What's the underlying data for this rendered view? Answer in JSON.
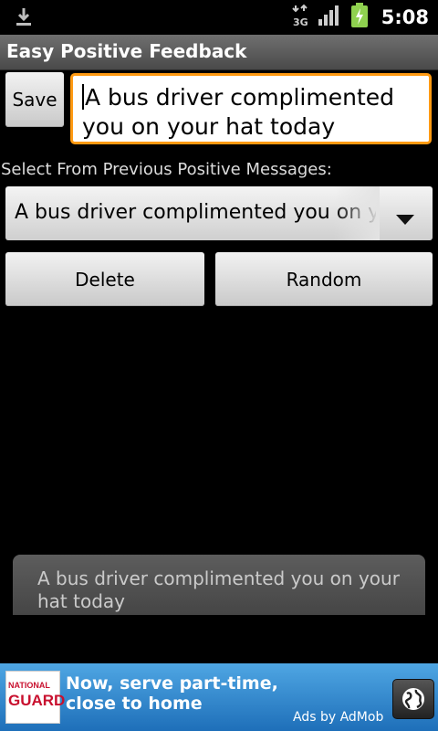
{
  "status_bar": {
    "time": "5:08",
    "network": "3G",
    "icons": [
      "download-icon",
      "network-3g-icon",
      "signal-icon",
      "battery-charging-icon"
    ]
  },
  "app": {
    "title": "Easy Positive Feedback"
  },
  "editor": {
    "save_label": "Save",
    "message_value": "A bus driver complimented you on your hat today"
  },
  "previous": {
    "prompt": "Select From Previous Positive Messages:",
    "selected": "A bus driver complimented you on your hat today"
  },
  "actions": {
    "delete_label": "Delete",
    "random_label": "Random"
  },
  "toast": {
    "text": "A bus driver complimented you on your hat today"
  },
  "ad": {
    "logo_line1": "NATIONAL",
    "logo_line2": "GUARD",
    "headline": "Now, serve part-time, close to home",
    "credit": "Ads by AdMob"
  },
  "colors": {
    "focus": "#ff9a12",
    "title_bar": "#5a5a5a",
    "ad_bg": "#2f86cd"
  }
}
